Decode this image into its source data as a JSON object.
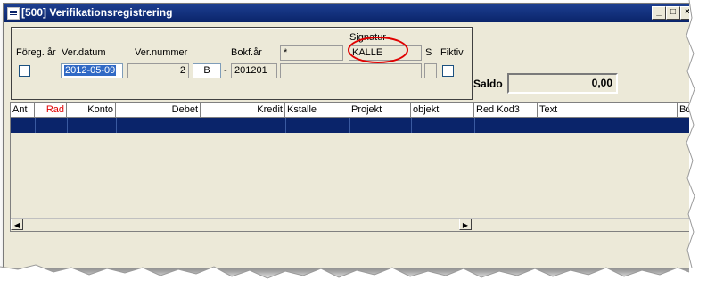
{
  "window": {
    "title": "[500]  Verifikationsregistrering",
    "minimize_glyph": "_",
    "maximize_glyph": "□",
    "close_glyph": "×"
  },
  "header": {
    "labels": {
      "foreg_ar": "Föreg. år",
      "ver_datum": "Ver.datum",
      "ver_nummer": "Ver.nummer",
      "bokf_ar": "Bokf.år",
      "signatur": "Signatur",
      "s": "S",
      "fiktiv": "Fiktiv"
    },
    "values": {
      "ver_datum": "2012-05-09",
      "ver_nummer": "2",
      "ver_serie": "B",
      "dash": "-",
      "bokf_ar": "201201",
      "star": "*",
      "signatur": "KALLE"
    }
  },
  "saldo": {
    "label": "Saldo",
    "value": "0,00"
  },
  "grid": {
    "columns": [
      "Ant",
      "Rad",
      "Konto",
      "Debet",
      "Kredit",
      "Kstalle",
      "Projekt",
      "objekt",
      "Red Kod3",
      "Text",
      "Bok"
    ]
  },
  "colors": {
    "title_bar": "#0a246a",
    "selected_row": "#0a246a",
    "annotation_circle": "#e00000",
    "rad_header": "#e00000"
  }
}
